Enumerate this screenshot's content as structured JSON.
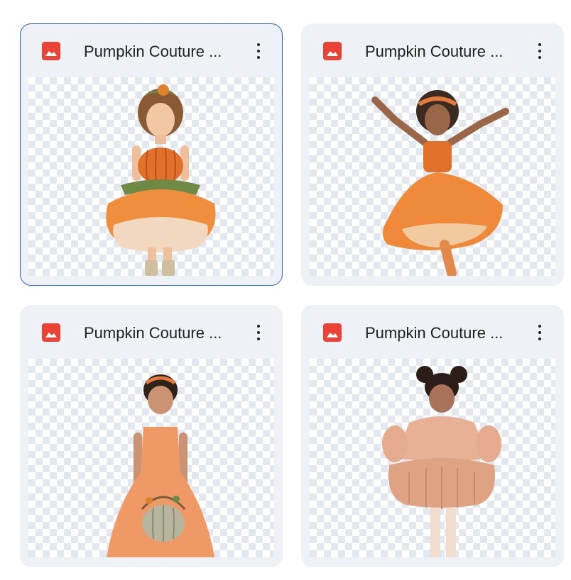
{
  "files": [
    {
      "title": "Pumpkin Couture ...",
      "icon": "image-file-icon",
      "more_icon": "more-vert-icon",
      "selected": true
    },
    {
      "title": "Pumpkin Couture ...",
      "icon": "image-file-icon",
      "more_icon": "more-vert-icon",
      "selected": false
    },
    {
      "title": "Pumpkin Couture ...",
      "icon": "image-file-icon",
      "more_icon": "more-vert-icon",
      "selected": false
    },
    {
      "title": "Pumpkin Couture ...",
      "icon": "image-file-icon",
      "more_icon": "more-vert-icon",
      "selected": false
    }
  ],
  "colors": {
    "icon_red": "#ea4335",
    "card_bg": "#eef1f6",
    "selected_border": "#2a62d6",
    "checker": "#e3e7ee"
  }
}
